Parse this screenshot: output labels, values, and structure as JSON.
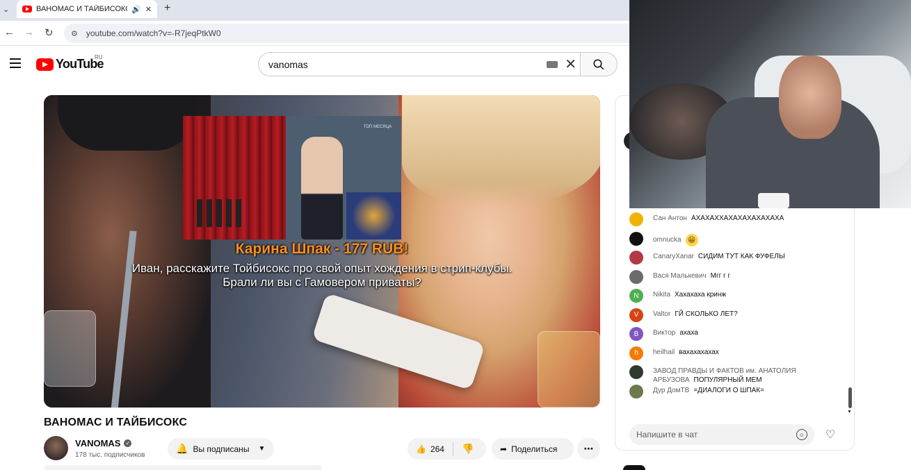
{
  "browser": {
    "tab_title": "ВАНОМАС И ТАЙБИСОКС",
    "url": "youtube.com/watch?v=-R7jeqPtkW0"
  },
  "header": {
    "logo_text": "YouTube",
    "region": "RU",
    "search_value": "vanomas"
  },
  "player": {
    "inset_caption": "ТОП МЕСЯЦА",
    "donation_name": "Карина Шпак - 177 RUB!",
    "donation_message": "Иван, расскажите Тойбисокс про свой опыт хождения в стрип-клубы. Брали ли вы с Гамовером приваты?"
  },
  "video": {
    "title": "ВАНОМАС И ТАЙБИСОКС",
    "channel_name": "VANOMAS",
    "subscribers": "178 тыс. подписчиков",
    "subscribed_label": "Вы подписаны",
    "like_count": "264",
    "share_label": "Поделиться"
  },
  "chat": {
    "messages": [
      {
        "author": "Сан Антон",
        "text": "АХАХАХХАХАХАХАХАХАХА",
        "avatar_color": "#f0b400",
        "initial": ""
      },
      {
        "author": "omnucka",
        "text": "😁",
        "avatar_color": "#111111",
        "initial": ""
      },
      {
        "author": "CanaryXanar",
        "text": "СИДИМ ТУТ КАК ФУФЕЛЫ",
        "avatar_color": "#b23a48",
        "initial": ""
      },
      {
        "author": "Вася Малькевич",
        "text": "Мгг г г",
        "avatar_color": "#6b6b6b",
        "initial": ""
      },
      {
        "author": "Nikita",
        "text": "Хахахаха кринж",
        "avatar_color": "#4caf50",
        "initial": "N"
      },
      {
        "author": "Valtor",
        "text": "ГЙ СКОЛЬКО ЛЕТ?",
        "avatar_color": "#d84315",
        "initial": "V"
      },
      {
        "author": "Виктор",
        "text": "ахаха",
        "avatar_color": "#7e57c2",
        "initial": "В"
      },
      {
        "author": "heilhail",
        "text": "вахахахахах",
        "avatar_color": "#f57c00",
        "initial": "h"
      },
      {
        "author": "ЗАВОД ПРАВДЫ И ФАКТОВ им. АНАТОЛИЯ АРБУЗОВА",
        "text": "ПОПУЛЯРНЫЙ МЕМ",
        "avatar_color": "#2e3b2e",
        "initial": ""
      },
      {
        "author": "Дур ДомТВ",
        "text": "=ДИАЛОГИ О ШПАК=",
        "avatar_color": "#6d7a4f",
        "initial": ""
      }
    ],
    "input_placeholder": "Напишите в чат"
  }
}
